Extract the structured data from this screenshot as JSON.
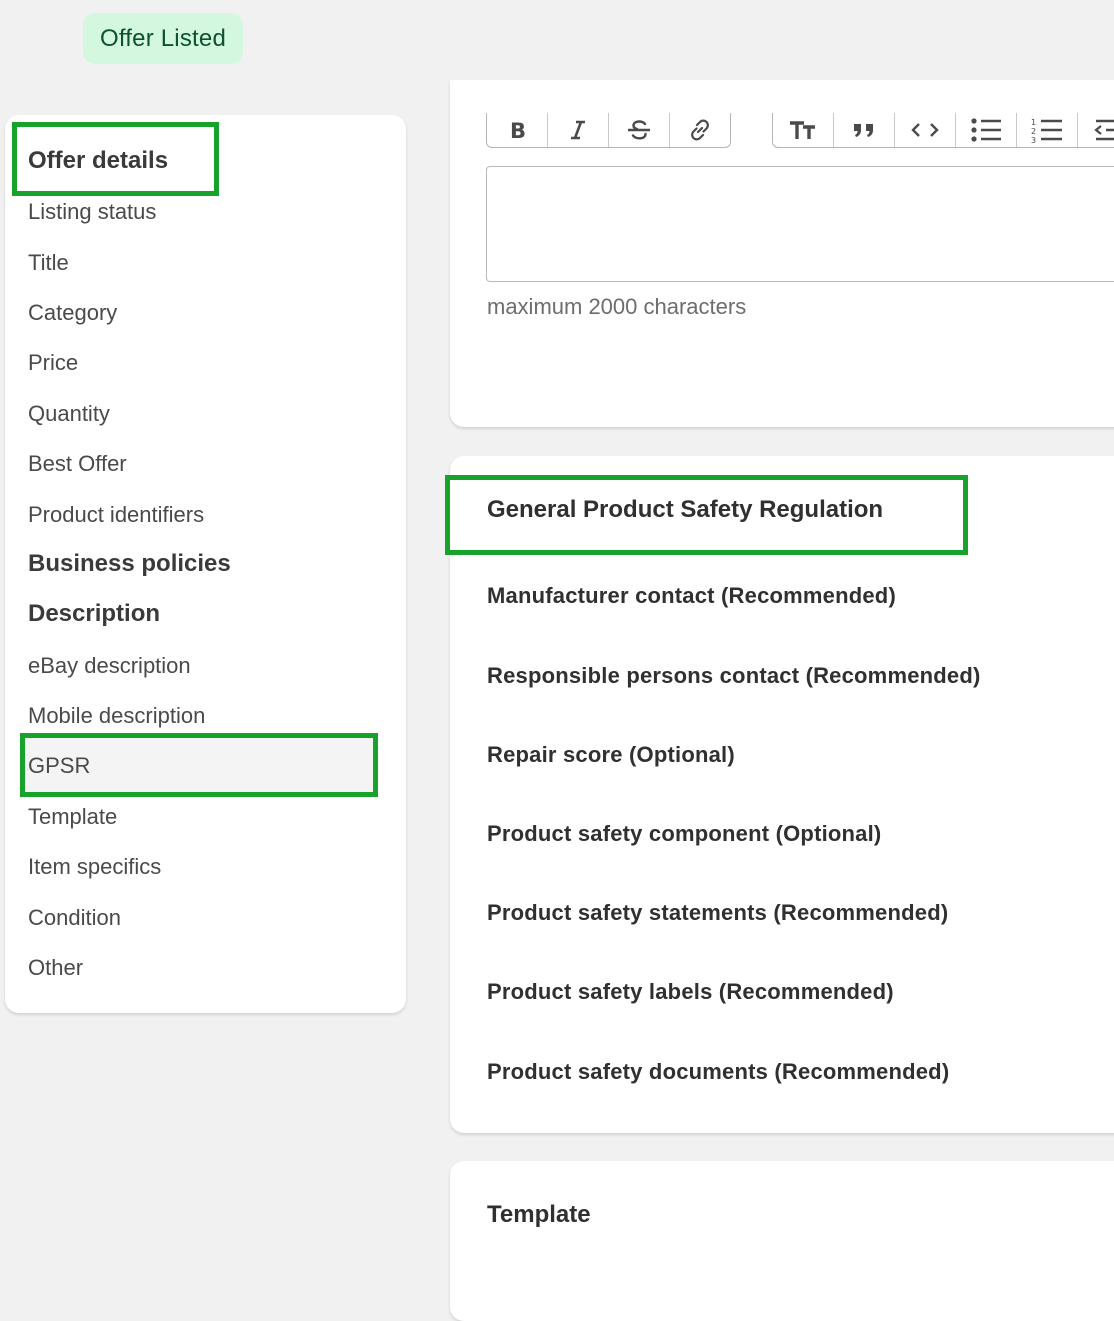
{
  "status": {
    "label": "Offer Listed",
    "color": "#d4f7df"
  },
  "sidebar": {
    "items": [
      {
        "label": "Offer details",
        "heading": true
      },
      {
        "label": "Listing status"
      },
      {
        "label": "Title"
      },
      {
        "label": "Category"
      },
      {
        "label": "Price"
      },
      {
        "label": "Quantity"
      },
      {
        "label": "Best Offer"
      },
      {
        "label": "Product identifiers"
      },
      {
        "label": "Business policies",
        "heading": true
      },
      {
        "label": "Description",
        "heading": true
      },
      {
        "label": "eBay description"
      },
      {
        "label": "Mobile description"
      },
      {
        "label": "GPSR",
        "active": true
      },
      {
        "label": "Template"
      },
      {
        "label": "Item specifics"
      },
      {
        "label": "Condition"
      },
      {
        "label": "Other"
      }
    ]
  },
  "editor": {
    "toolbar_icons": [
      "bold-icon",
      "italic-icon",
      "strikethrough-icon",
      "link-icon",
      "text-size-icon",
      "quote-icon",
      "code-icon",
      "bullet-list-icon",
      "numbered-list-icon",
      "outdent-icon"
    ],
    "value": "",
    "hint": "maximum 2000 characters"
  },
  "gpsr": {
    "title": "General Product Safety Regulation",
    "fields": [
      "Manufacturer contact (Recommended)",
      "Responsible persons contact (Recommended)",
      "Repair score (Optional)",
      "Product safety component (Optional)",
      "Product safety statements (Recommended)",
      "Product safety labels (Recommended)",
      "Product safety documents (Recommended)"
    ]
  },
  "template_section": {
    "title": "Template"
  },
  "colors": {
    "highlight": "#17a32b",
    "background": "#f1f1f1"
  }
}
